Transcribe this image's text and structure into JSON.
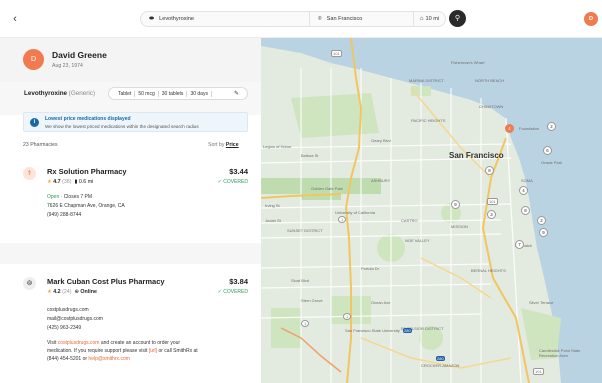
{
  "topbar": {
    "back_icon": "chevron-left-icon",
    "medication": "Levothyroxine",
    "location": "San Francisco",
    "radius": "10 mi",
    "user_initial": "D"
  },
  "patient": {
    "initial": "D",
    "name": "David Greene",
    "dob": "Aug 23, 1974"
  },
  "drug": {
    "name": "Levothyroxine",
    "generic": "(Generic)",
    "form": "Tablet",
    "dose": "50 mcg",
    "quantity": "30 tablets",
    "days": "30 days"
  },
  "info": {
    "title": "Lowest price medications displayed",
    "subtitle": "We show the lowest priced medications within the designated search radius"
  },
  "results": {
    "count": "23 Pharmacies",
    "sort_label": "Sort by",
    "sort_value": "Price"
  },
  "pharmacies": [
    {
      "name": "Rx Solution Pharmacy",
      "price": "$3.44",
      "coverage": "COVERED",
      "rating": "4.7",
      "reviews": "(38)",
      "distance": "0.6 mi",
      "status": "Open",
      "hours": "Closes 7 PM",
      "address": "7626 E Chapman Ave, Orange, CA",
      "phone": "(949) 288-8744"
    },
    {
      "name": "Mark Cuban Cost Plus Pharmacy",
      "price": "$3.84",
      "coverage": "COVERED",
      "rating": "4.2",
      "reviews": "(24)",
      "channel": "Online",
      "website": "costplusdrugs.com",
      "email": "mail@costplusdrugs.com",
      "phone": "(425) 963-2349",
      "note_1a": "Visit ",
      "note_1b": "costplusdrugs.com",
      "note_1c": " and create an account to order your",
      "note_2a": "medication. If you require support please visit ",
      "note_2b": "[url]",
      "note_2c": " or call SmithRx at",
      "note_3a": "(844) 454-5201 or ",
      "note_3b": "help@smithrx.com"
    }
  ],
  "map": {
    "city": "San Francisco",
    "labels": [
      "Fisherman's Wharf",
      "MARINA DISTRICT",
      "NORTH BEACH",
      "CHINATOWN",
      "PACIFIC HEIGHTS",
      "Legion of Honor",
      "Balboa St",
      "Geary Blvd",
      "Golden Gate Park",
      "ASHBURY",
      "University of California",
      "Irving St",
      "Judah St",
      "SUNSET DISTRICT",
      "CASTRO",
      "NOE VALLEY",
      "MISSION",
      "BERNAL HEIGHTS",
      "Dogpatch",
      "Silver Terrace",
      "EXCELSIOR DISTRICT",
      "San Francisco State University",
      "Stern Grove",
      "CROCKER-AMAZON",
      "Candlestick Point State Recreation Area",
      "SOMA",
      "Oracle Park",
      "Foundation",
      "Sloat Blvd",
      "Ocean Ave",
      "Portola Dr"
    ],
    "pins": [
      "4",
      "2",
      "6",
      "8",
      "9",
      "4",
      "8",
      "3",
      "2",
      "9",
      "7"
    ],
    "route_badges": [
      "101",
      "1",
      "1",
      "101",
      "280",
      "280",
      "1",
      "101"
    ]
  }
}
